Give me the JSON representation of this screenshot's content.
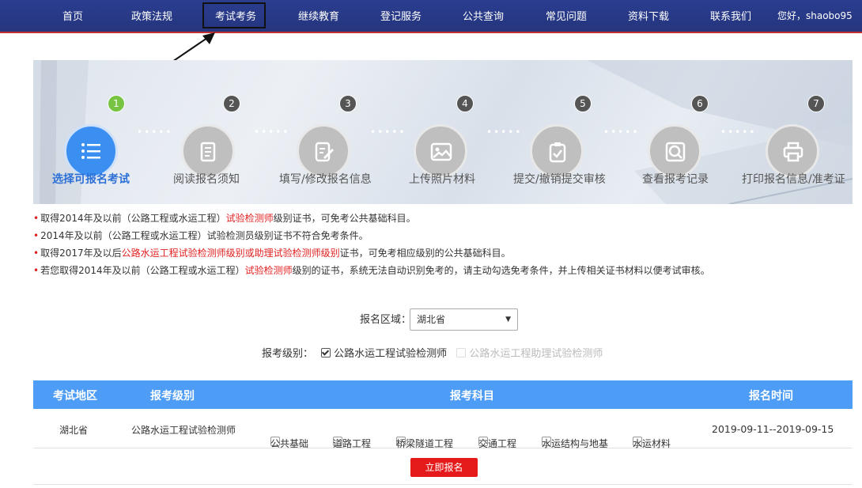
{
  "nav": {
    "items": [
      "首页",
      "政策法规",
      "考试考务",
      "继续教育",
      "登记服务",
      "公共查询",
      "常见问题",
      "资料下载",
      "联系我们"
    ],
    "greeting": "您好，shaobo95"
  },
  "steps": [
    {
      "num": "1",
      "label": "选择可报名考试",
      "icon": "list-icon"
    },
    {
      "num": "2",
      "label": "阅读报名须知",
      "icon": "document-icon"
    },
    {
      "num": "3",
      "label": "填写/修改报名信息",
      "icon": "edit-icon"
    },
    {
      "num": "4",
      "label": "上传照片材料",
      "icon": "image-icon"
    },
    {
      "num": "5",
      "label": "提交/撤销提交审核",
      "icon": "clipboard-check-icon"
    },
    {
      "num": "6",
      "label": "查看报考记录",
      "icon": "search-record-icon"
    },
    {
      "num": "7",
      "label": "打印报名信息/准考证",
      "icon": "printer-icon"
    }
  ],
  "notes": [
    {
      "pre": "取得2014年及以前（公路工程或水运工程）",
      "red": "试验检测师",
      "post": "级别证书，可免考公共基础科目。"
    },
    {
      "pre": "2014年及以前（公路工程或水运工程）试验检测员级别证书不符合免考条件。",
      "red": "",
      "post": ""
    },
    {
      "pre": "取得2017年及以后",
      "red": "公路水运工程试验检测师级别或助理试验检测师级别",
      "post": "证书，可免考相应级别的公共基础科目。"
    },
    {
      "pre": "若您取得2014年及以前（公路工程或水运工程）",
      "red": "试验检测师",
      "post": "级别的证书，系统无法自动识别免考的，请主动勾选免考条件，并上传相关证书材料以便考试审核。"
    }
  ],
  "form": {
    "region_label": "报名区域：",
    "region_value": "湖北省",
    "level_label": "报考级别：",
    "level_options": [
      {
        "label": "公路水运工程试验检测师",
        "checked": true,
        "disabled": false
      },
      {
        "label": "公路水运工程助理试验检测师",
        "checked": false,
        "disabled": true
      }
    ]
  },
  "table": {
    "headers": [
      "考试地区",
      "报考级别",
      "报考科目",
      "报名时间"
    ],
    "row": {
      "region": "湖北省",
      "level": "公路水运工程试验检测师",
      "subjects": [
        "公共基础",
        "道路工程",
        "桥梁隧道工程",
        "交通工程",
        "水运结构与地基",
        "水运材料"
      ],
      "time": "2019-09-11--2019-09-15"
    }
  },
  "apply_button": "立即报名",
  "colors": {
    "nav_bg": "#25357e",
    "accent_red": "#e51b1b",
    "table_header": "#4d9cf6",
    "active_step": "#3b8ff1",
    "badge_active": "#76c441"
  }
}
